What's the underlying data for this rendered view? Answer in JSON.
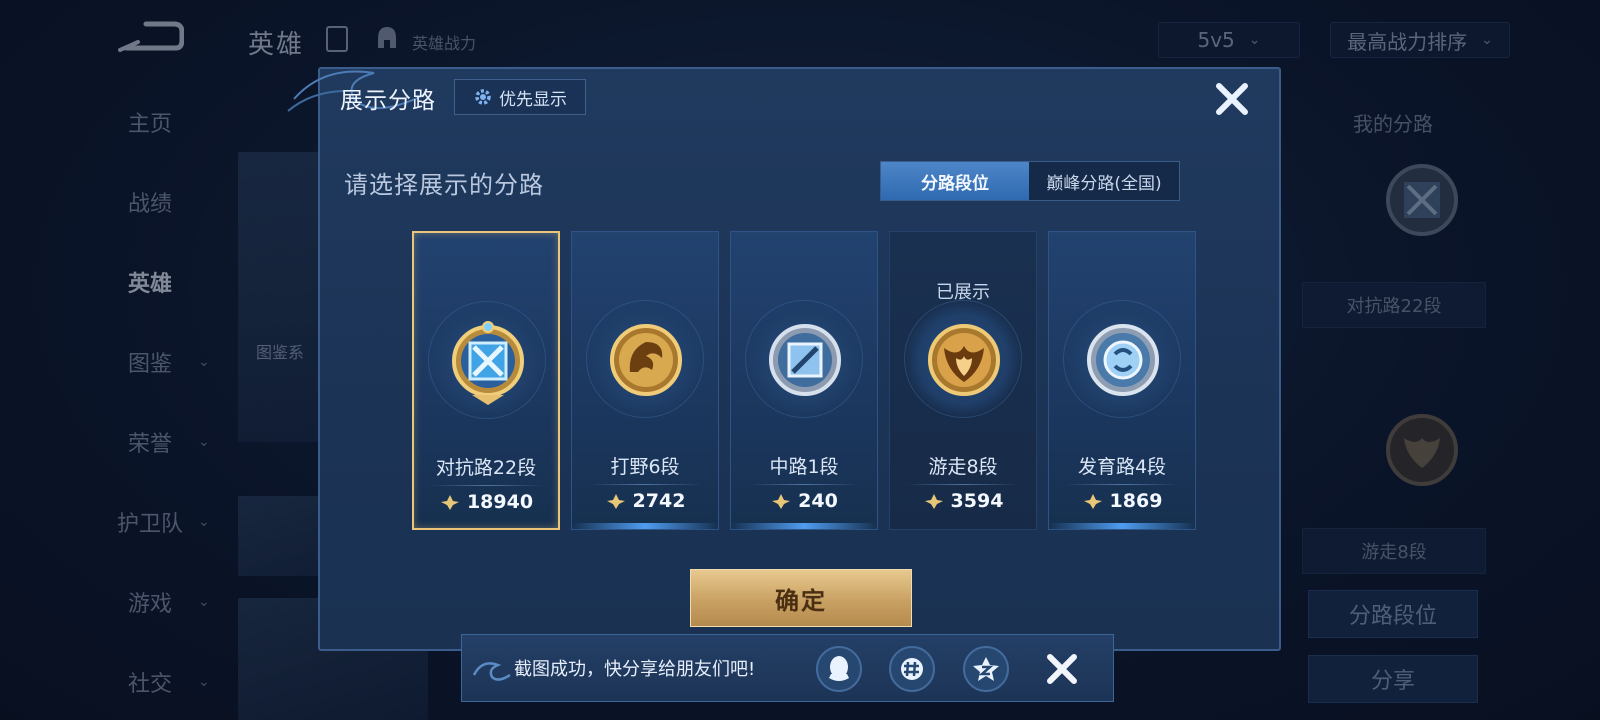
{
  "background": {
    "header": {
      "title": "英雄",
      "subtitle": "英雄战力",
      "mode_dropdown": "5v5",
      "sort_dropdown": "最高战力排序"
    },
    "nav": [
      {
        "label": "主页",
        "has_chevron": false,
        "active": false
      },
      {
        "label": "战绩",
        "has_chevron": false,
        "active": false
      },
      {
        "label": "英雄",
        "has_chevron": false,
        "active": true
      },
      {
        "label": "图鉴",
        "has_chevron": true,
        "active": false
      },
      {
        "label": "荣誉",
        "has_chevron": true,
        "active": false
      },
      {
        "label": "护卫队",
        "has_chevron": true,
        "active": false
      },
      {
        "label": "游戏",
        "has_chevron": true,
        "active": false
      },
      {
        "label": "社交",
        "has_chevron": true,
        "active": false
      }
    ],
    "hero_card_bar_label": "图鉴系",
    "right_panel": {
      "title": "我的分路",
      "lane1_label": "对抗路22段",
      "lane2_label": "游走8段",
      "lane_rank_button": "分路段位",
      "share_button": "分享"
    }
  },
  "dialog": {
    "title": "展示分路",
    "priority_button": "优先显示",
    "subtitle": "请选择展示的分路",
    "tabs": [
      {
        "label": "分路段位",
        "active": true
      },
      {
        "label": "巅峰分路(全国)",
        "active": false
      }
    ],
    "lanes": [
      {
        "name": "对抗路22段",
        "score": "18940",
        "selected": true,
        "shown": false,
        "emblem": "clash-lane-emblem-icon"
      },
      {
        "name": "打野6段",
        "score": "2742",
        "selected": false,
        "shown": false,
        "emblem": "jungle-emblem-icon"
      },
      {
        "name": "中路1段",
        "score": "240",
        "selected": false,
        "shown": false,
        "emblem": "mid-lane-emblem-icon"
      },
      {
        "name": "游走8段",
        "score": "3594",
        "selected": false,
        "shown": true,
        "emblem": "roam-emblem-icon"
      },
      {
        "name": "发育路4段",
        "score": "1869",
        "selected": false,
        "shown": false,
        "emblem": "farm-lane-emblem-icon"
      }
    ],
    "shown_tag": "已展示",
    "confirm_button": "确定"
  },
  "toast": {
    "message": "截图成功，快分享给朋友们吧!",
    "share_targets": [
      "qq-icon",
      "moments-icon",
      "qzone-icon"
    ]
  },
  "colors": {
    "accent_gold": "#e9c67a",
    "tab_active": "#3d78bd",
    "dialog_bg": "#1d365a"
  }
}
